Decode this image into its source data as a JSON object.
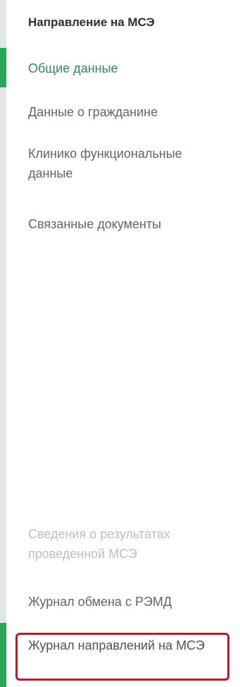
{
  "sidebar": {
    "title": "Направление на МСЭ",
    "items": [
      {
        "label": "Общие данные",
        "state": "active"
      },
      {
        "label": "Данные о гражданине",
        "state": "normal"
      },
      {
        "label": "Клинико функциональные данные",
        "state": "normal"
      },
      {
        "label": "Связанные документы",
        "state": "normal"
      }
    ],
    "bottom_items": [
      {
        "label": "Сведения о результатах проведенной МСЭ",
        "state": "disabled"
      },
      {
        "label": "Журнал обмена с РЭМД",
        "state": "normal"
      },
      {
        "label": "Журнал направлений на МСЭ",
        "state": "active-highlighted"
      }
    ]
  },
  "colors": {
    "accent_green": "#2aa85a",
    "active_text": "#2f8a5c",
    "highlight_border": "#c0162b"
  }
}
